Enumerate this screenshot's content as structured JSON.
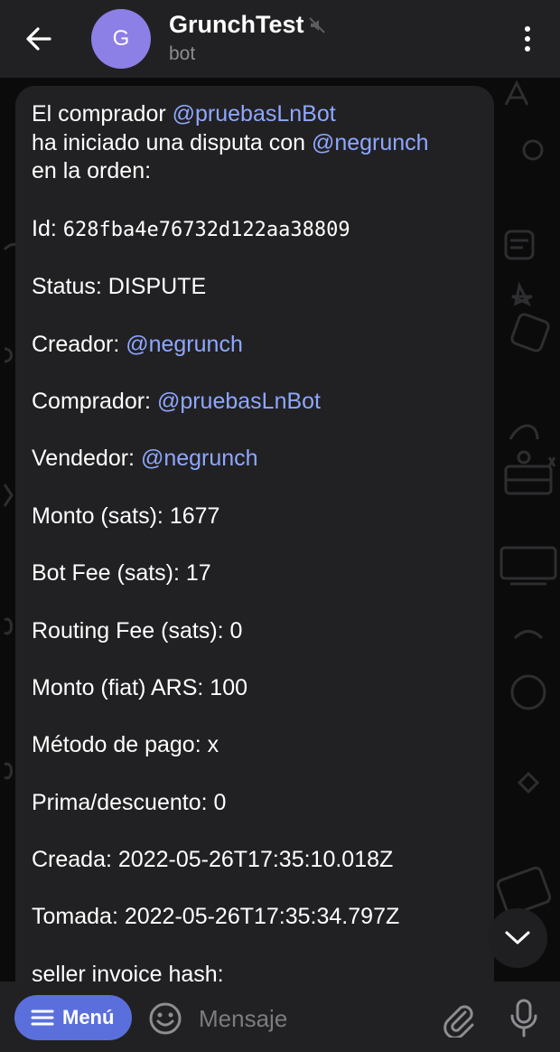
{
  "header": {
    "back_icon": "arrow-left-icon",
    "avatar_letter": "G",
    "avatar_color": "#8c7fe6",
    "title": "GrunchTest",
    "muted_icon": "muted-speaker-icon",
    "subtitle": "bot",
    "more_icon": "vertical-dots-icon"
  },
  "message": {
    "intro_1_prefix": "El comprador ",
    "intro_1_mention": "@pruebasLnBot",
    "intro_2_prefix": "ha iniciado una disputa con ",
    "intro_2_mention": "@negrunch",
    "intro_3": "en la orden:",
    "id_label": "Id: ",
    "id_value": "628fba4e76732d122aa38809",
    "status_label": "Status: ",
    "status_value": "DISPUTE",
    "creator_label": "Creador: ",
    "creator_value": "@negrunch",
    "buyer_label": "Comprador: ",
    "buyer_value": "@pruebasLnBot",
    "seller_label": "Vendedor: ",
    "seller_value": "@negrunch",
    "amount_label": "Monto (sats): ",
    "amount_value": "1677",
    "bot_fee_label": "Bot Fee (sats): ",
    "bot_fee_value": "17",
    "routing_fee_label": "Routing Fee (sats): ",
    "routing_fee_value": "0",
    "fiat_label": "Monto (fiat) ARS: ",
    "fiat_value": "100",
    "payment_label": "Método de pago: ",
    "payment_value": "x",
    "premium_label": "Prima/descuento: ",
    "premium_value": "0",
    "created_label": "Creada: ",
    "created_value": "2022-05-26T17:35:10.018Z",
    "taken_label": "Tomada: ",
    "taken_value": "2022-05-26T17:35:34.797Z",
    "invoice_label": "seller invoice hash:"
  },
  "composer": {
    "menu_label": "Menú",
    "menu_icon": "hamburger-icon",
    "emoji_icon": "emoji-icon",
    "placeholder": "Mensaje",
    "attach_icon": "paperclip-icon",
    "mic_icon": "microphone-icon"
  },
  "colors": {
    "accent": "#5b6fdc",
    "mention": "#8fa7ff",
    "bubble": "#212123"
  }
}
